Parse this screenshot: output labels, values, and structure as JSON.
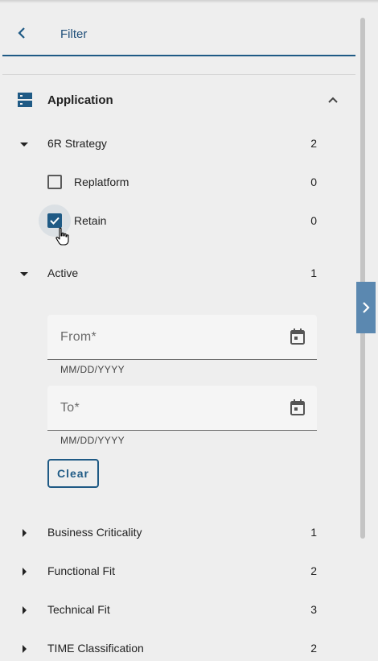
{
  "header": {
    "title": "Filter",
    "back_icon": "chevron-left-icon"
  },
  "section": {
    "title": "Application",
    "icon": "list-view-icon",
    "toggle_icon": "chevron-up-icon"
  },
  "facets": {
    "strategy": {
      "label": "6R Strategy",
      "count": "2",
      "expanded": true,
      "options": [
        {
          "label": "Replatform",
          "count": "0",
          "checked": false
        },
        {
          "label": "Retain",
          "count": "0",
          "checked": true
        }
      ]
    },
    "active": {
      "label": "Active",
      "count": "1",
      "expanded": true,
      "from": {
        "placeholder": "From*",
        "hint": "MM/DD/YYYY"
      },
      "to": {
        "placeholder": "To*",
        "hint": "MM/DD/YYYY"
      },
      "clear_label": "Clear"
    },
    "collapsed": [
      {
        "label": "Business Criticality",
        "count": "1"
      },
      {
        "label": "Functional Fit",
        "count": "2"
      },
      {
        "label": "Technical Fit",
        "count": "3"
      },
      {
        "label": "TIME Classification",
        "count": "2"
      }
    ]
  },
  "colors": {
    "accent": "#1f5a85",
    "panel_toggle": "#5b88b0",
    "background": "#eeeeee"
  }
}
